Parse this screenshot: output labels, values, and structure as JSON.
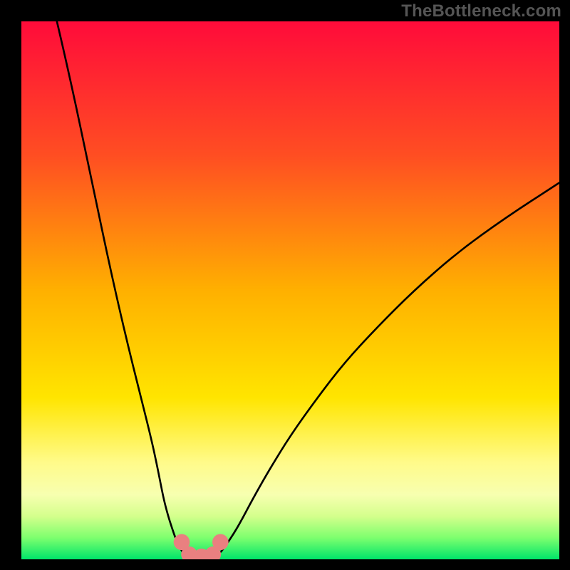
{
  "watermark": "TheBottleneck.com",
  "chart_data": {
    "type": "line",
    "title": "",
    "xlabel": "",
    "ylabel": "",
    "xlim": [
      0,
      100
    ],
    "ylim": [
      0,
      100
    ],
    "gradient_stops": [
      {
        "offset": 0,
        "color": "#ff0b3a"
      },
      {
        "offset": 0.25,
        "color": "#ff4e22"
      },
      {
        "offset": 0.5,
        "color": "#ffb000"
      },
      {
        "offset": 0.7,
        "color": "#ffe500"
      },
      {
        "offset": 0.82,
        "color": "#fffb8a"
      },
      {
        "offset": 0.88,
        "color": "#f7ffb0"
      },
      {
        "offset": 0.92,
        "color": "#d4ff8c"
      },
      {
        "offset": 0.96,
        "color": "#7dff6e"
      },
      {
        "offset": 1.0,
        "color": "#00e56a"
      }
    ],
    "series": [
      {
        "name": "left-branch",
        "x": [
          6.6,
          8,
          10,
          12,
          14,
          16,
          18,
          20,
          22,
          24,
          25,
          25.8,
          26.5,
          27.3,
          28,
          28.7,
          29.4,
          30
        ],
        "y": [
          100,
          94,
          85,
          75.5,
          66,
          56.5,
          47.5,
          39,
          31,
          23,
          18.5,
          14.5,
          11,
          8,
          5.8,
          3.8,
          2.4,
          1.2
        ]
      },
      {
        "name": "minimum-plateau",
        "x": [
          30,
          31,
          32.5,
          34,
          35.5,
          37
        ],
        "y": [
          1.2,
          0.4,
          0.15,
          0.15,
          0.4,
          1.2
        ]
      },
      {
        "name": "right-branch",
        "x": [
          37,
          38,
          39.5,
          41,
          43,
          46,
          50,
          55,
          60,
          66,
          73,
          81,
          90,
          100
        ],
        "y": [
          1.2,
          2.6,
          4.8,
          7.4,
          11.2,
          16.5,
          23,
          30,
          36.5,
          43,
          50,
          57,
          63.5,
          70
        ]
      }
    ],
    "markers": [
      {
        "x": 29.8,
        "y": 3.2
      },
      {
        "x": 31.2,
        "y": 0.9
      },
      {
        "x": 33.5,
        "y": 0.5
      },
      {
        "x": 35.6,
        "y": 0.9
      },
      {
        "x": 37.0,
        "y": 3.2
      }
    ],
    "marker_color": "#e98080",
    "marker_radius_pct": 1.5,
    "line_width_pct": 0.35
  }
}
